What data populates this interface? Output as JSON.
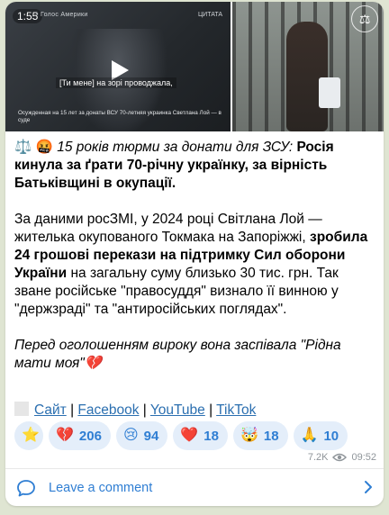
{
  "video": {
    "duration": "1:55",
    "brand": "• Голос Америки",
    "brand_right": "ЦИТАТА",
    "quote": "[Ти мене] на зорі проводжала,",
    "caption": "Осужденная на 15 лет за донаты ВСУ 70-летняя украинка Светлана Лой — в суде"
  },
  "photo": {
    "badge": "⚖"
  },
  "post": {
    "line1_emoji": "⚖️ 🤬",
    "line1_italic": "15 років тюрми за донати для ЗСУ:",
    "line1_bold": "Росія кинула за ґрати 70-річну українку, за вірність Батьківщині в окупації.",
    "p2_a": "За даними росЗМІ, у 2024 році Світлана Лой — жителька окупованого Токмака на Запоріжжі,",
    "p2_bold": "зробила 24 грошові перекази на підтримку Сил оборони України",
    "p2_b": "на загальну суму близько 30 тис. грн. Так зване російське \"правосуддя\" визнало її винною у \"держзраді\" та \"антиросійських поглядах\".",
    "p3_italic": "Перед оголошенням вироку вона заспівала \"Рідна мати моя\"💔"
  },
  "links": {
    "site": "Сайт",
    "sep": "|",
    "facebook": "Facebook",
    "youtube": "YouTube",
    "tiktok": "TikTok"
  },
  "reactions": [
    {
      "emoji": "⭐",
      "count": ""
    },
    {
      "emoji": "💔",
      "count": "206"
    },
    {
      "emoji": "😢",
      "count": "94"
    },
    {
      "emoji": "❤️",
      "count": "18"
    },
    {
      "emoji": "🤯",
      "count": "18"
    },
    {
      "emoji": "🙏",
      "count": "10"
    }
  ],
  "meta": {
    "views": "7.2K",
    "time": "09:52"
  },
  "comment": {
    "label": "Leave a comment"
  },
  "colors": {
    "accent": "#2f7ed3",
    "reaction_bg": "#e4eefa",
    "background": "#dfe5d2"
  }
}
